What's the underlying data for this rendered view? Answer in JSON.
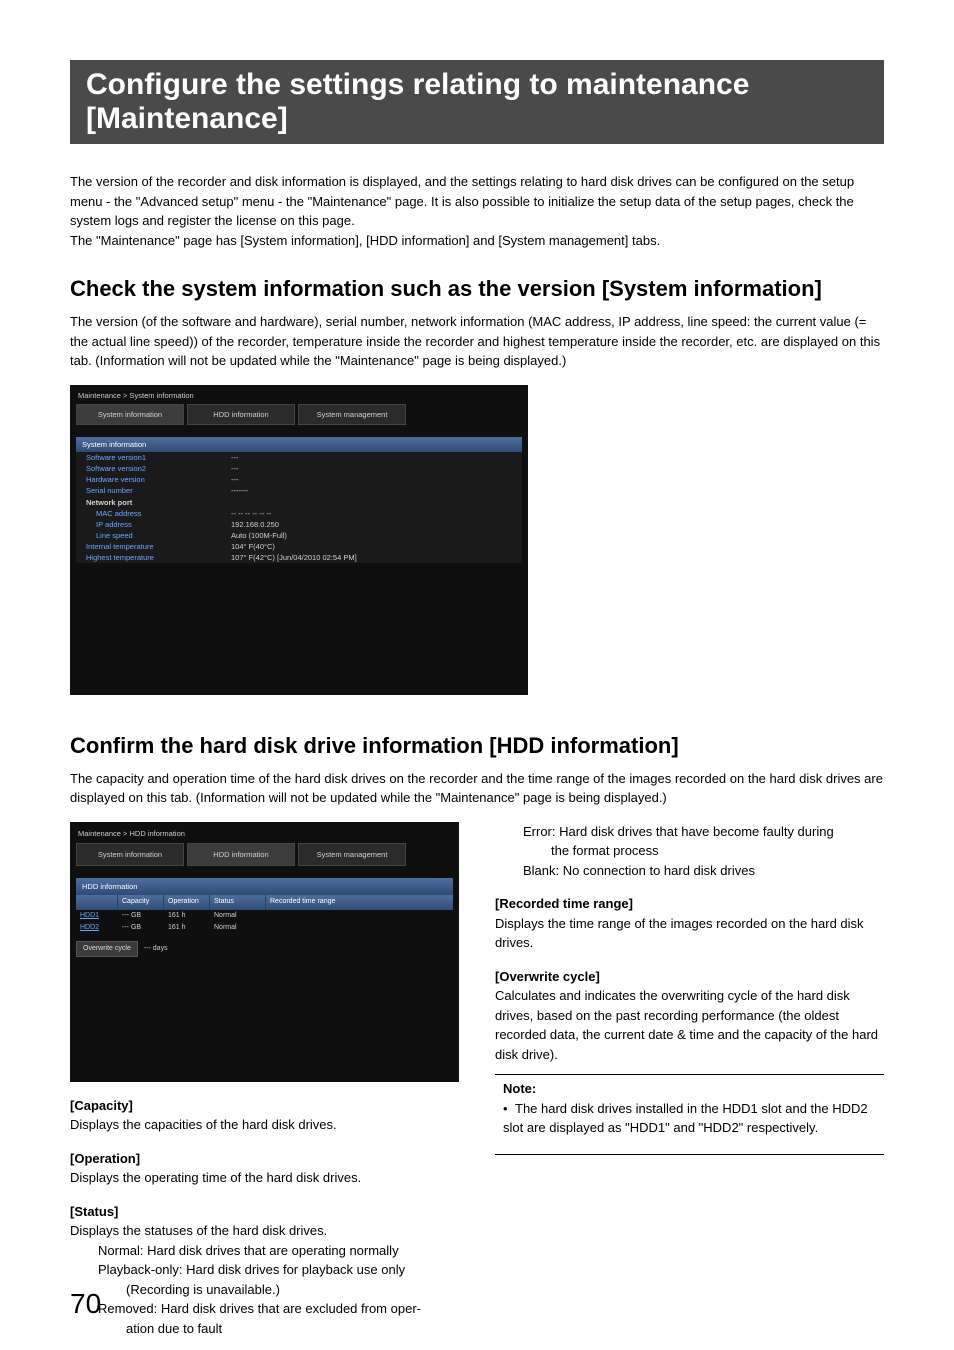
{
  "title": "Configure the settings relating to maintenance [Maintenance]",
  "intro_p1": "The version of the recorder and disk information is displayed, and the settings relating to hard disk drives can be configured on the setup menu - the \"Advanced setup\" menu - the \"Maintenance\" page. It is also possible to initialize the setup data of the setup pages, check the system logs and register the license on this page.",
  "intro_p2": "The \"Maintenance\" page has [System information], [HDD information] and [System management] tabs.",
  "section1": {
    "heading": "Check the system information such as the version [System information]",
    "desc": "The version (of the software and hardware), serial number, network information (MAC address, IP address, line speed: the current value (= the actual line speed)) of the recorder, temperature inside the recorder and highest temperature inside the recorder, etc. are displayed on this tab. (Information will not be updated while the \"Maintenance\" page is being displayed.)"
  },
  "ss1": {
    "breadcrumb": "Maintenance > System information",
    "tabs": [
      "System information",
      "HDD information",
      "System management"
    ],
    "panel_title": "System information",
    "rows": [
      {
        "label": "Software version1",
        "value": "---"
      },
      {
        "label": "Software version2",
        "value": "---"
      },
      {
        "label": "Hardware version",
        "value": "---"
      },
      {
        "label": "Serial number",
        "value": "-------"
      }
    ],
    "net_head": "Network port",
    "net_rows": [
      {
        "label": "MAC address",
        "value": "-- -- -- -- -- --"
      },
      {
        "label": "IP address",
        "value": "192.168.0.250"
      },
      {
        "label": "Line speed",
        "value": "Auto (100M-Full)"
      }
    ],
    "temp_rows": [
      {
        "label": "Internal temperature",
        "value": "104° F(40°C)"
      },
      {
        "label": "Highest temperature",
        "value": "107° F(42°C) [Jun/04/2010 02:54 PM]"
      }
    ]
  },
  "section2": {
    "heading": "Confirm the hard disk drive information [HDD information]",
    "desc": "The capacity and operation time of the hard disk drives on the recorder and the time range of the images recorded on the hard disk drives are displayed on this tab. (Information will not be updated while the \"Maintenance\" page is being displayed.)"
  },
  "ss2": {
    "breadcrumb": "Maintenance > HDD information",
    "tabs": [
      "System information",
      "HDD information",
      "System management"
    ],
    "panel_title": "HDD information",
    "columns": [
      "",
      "Capacity",
      "Operation",
      "Status",
      "Recorded time range"
    ],
    "rows": [
      {
        "name": "HDD1",
        "capacity": "--- GB",
        "operation": "161 h",
        "status": "Normal",
        "range": ""
      },
      {
        "name": "HDD2",
        "capacity": "--- GB",
        "operation": "161 h",
        "status": "Normal",
        "range": ""
      }
    ],
    "overwrite_label": "Overwrite cycle",
    "overwrite_value": "--- days"
  },
  "left_col": {
    "capacity_h": "[Capacity]",
    "capacity_t": "Displays the capacities of the hard disk drives.",
    "operation_h": "[Operation]",
    "operation_t": "Displays the operating time of the hard disk drives.",
    "status_h": "[Status]",
    "status_t": "Displays the statuses of the hard disk drives.",
    "status_l1": "Normal: Hard disk drives that are operating normally",
    "status_l2": "Playback-only: Hard disk drives for playback use only",
    "status_l2b": "(Recording is unavailable.)",
    "status_l3a": "Removed: Hard disk drives that are excluded from oper-",
    "status_l3b": "ation due to fault"
  },
  "right_col": {
    "status_l4a": "Error: Hard disk drives that have become faulty during",
    "status_l4b": "the format process",
    "status_l5": "Blank: No connection to hard disk drives",
    "rtr_h": "[Recorded time range]",
    "rtr_t": "Displays the time range of the images recorded on the hard disk drives.",
    "ow_h": "[Overwrite cycle]",
    "ow_t": "Calculates and indicates the overwriting cycle of the hard disk drives, based on the past recording performance (the oldest recorded data, the current date & time and the capacity of the hard disk drive).",
    "note_h": "Note:",
    "note_b": "The hard disk drives installed in the HDD1 slot and the HDD2 slot are displayed as \"HDD1\" and \"HDD2\" respectively."
  },
  "page_number": "70"
}
